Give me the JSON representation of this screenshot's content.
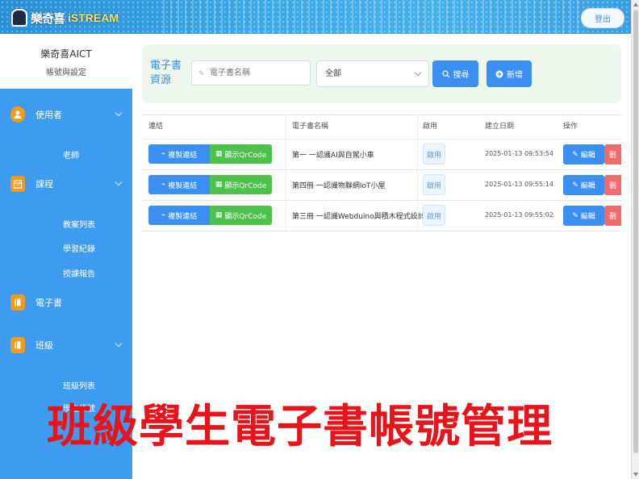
{
  "header": {
    "logo_text_main": "樂奇喜",
    "logo_text_accent": "iSTREAM",
    "login_label": "登出"
  },
  "user": {
    "org_name": "樂奇喜AICT",
    "account_label": "帳號與設定"
  },
  "sidebar": {
    "sections": [
      {
        "label": "使用者",
        "icon": "user-icon",
        "items": [
          "老師"
        ]
      },
      {
        "label": "課程",
        "icon": "calendar-icon",
        "items": [
          "教案列表",
          "學習紀錄",
          "授課報告"
        ]
      },
      {
        "label": "電子書",
        "icon": "book-icon",
        "items": []
      },
      {
        "label": "班級",
        "icon": "class-icon",
        "items": [
          "班級列表",
          "學生帳號"
        ]
      }
    ]
  },
  "search": {
    "title": "電子書資源",
    "input_placeholder": "電子書名稱",
    "select_value": "全部",
    "search_button": "搜尋",
    "add_button": "新增"
  },
  "table": {
    "headers": [
      "連結",
      "電子書名稱",
      "啟用",
      "建立日期",
      "操作"
    ],
    "rows": [
      {
        "link_label": "複製連結",
        "qr_label": "顯示QrCode",
        "name": "第一 一認識AI與自駕小車",
        "status": "啟用",
        "date": "2025-01-13 09:53:54",
        "edit_label": "編輯",
        "delete_label": "刪"
      },
      {
        "link_label": "複製連結",
        "qr_label": "顯示QrCode",
        "name": "第四冊 一認識物聯網IoT小屋",
        "status": "啟用",
        "date": "2025-01-13 09:55:14",
        "edit_label": "編輯",
        "delete_label": "刪"
      },
      {
        "link_label": "複製連結",
        "qr_label": "顯示QrCode",
        "name": "第三冊 一認識Webduino與積木程式設計",
        "status": "啟用",
        "date": "2025-01-13 09:55:02",
        "edit_label": "編輯",
        "delete_label": "刪"
      }
    ]
  },
  "overlay_title": "班級學生電子書帳號管理",
  "colors": {
    "primary": "#3b8ff0",
    "success": "#4cc14c",
    "danger": "#f06b6b",
    "sidebar": "#3d9cf0",
    "overlay": "#e8141b"
  }
}
